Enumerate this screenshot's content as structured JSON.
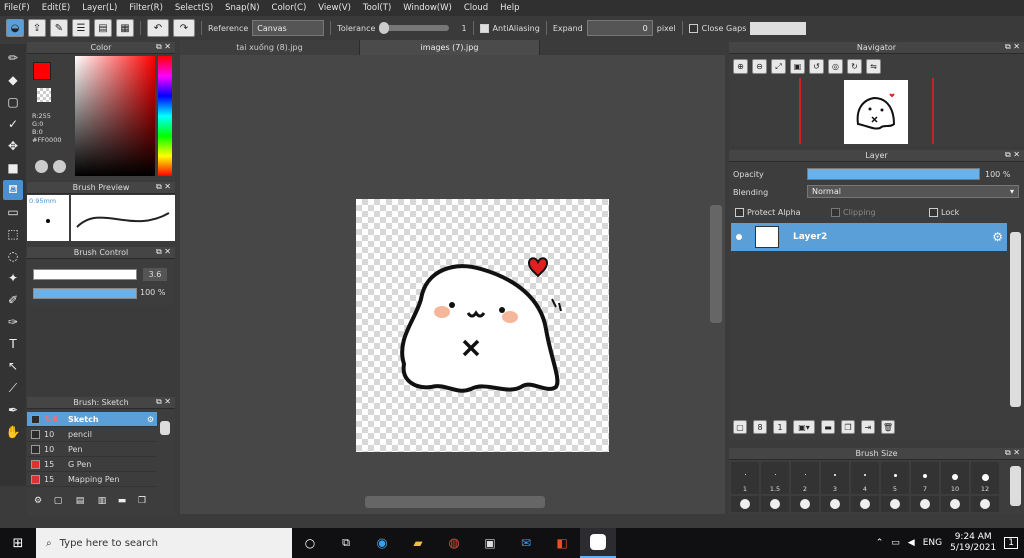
{
  "menu": [
    "File(F)",
    "Edit(E)",
    "Layer(L)",
    "Filter(R)",
    "Select(S)",
    "Snap(N)",
    "Color(C)",
    "View(V)",
    "Tool(T)",
    "Window(W)",
    "Cloud",
    "Help"
  ],
  "toolbar": {
    "reference_label": "Reference",
    "reference_value": "Canvas",
    "tolerance_label": "Tolerance",
    "tolerance_value": "1",
    "antialiasing_label": "AntiAliasing",
    "expand_label": "Expand",
    "expand_value": "0",
    "pixel_label": "pixel",
    "close_gaps_label": "Close Gaps"
  },
  "color_panel": {
    "title": "Color",
    "r": "R:255",
    "g": "G:0",
    "b": "B:0",
    "hex": "#FF0000",
    "primary": "#ff0000"
  },
  "brush_preview": {
    "title": "Brush Preview",
    "size": "0.95mm"
  },
  "brush_control": {
    "title": "Brush Control",
    "size_value": "3.6",
    "size_fraction": 0.98,
    "opacity_value": "100 %",
    "opacity_fraction": 1.0
  },
  "brush_list": {
    "title": "Brush: Sketch",
    "items": [
      {
        "size": "3.6",
        "name": "Sketch",
        "color": "#2b2b2b",
        "selected": true
      },
      {
        "size": "10",
        "name": "pencil",
        "color": "#2b2b2b",
        "selected": false
      },
      {
        "size": "10",
        "name": "Pen",
        "color": "#2b2b2b",
        "selected": false
      },
      {
        "size": "15",
        "name": "G Pen",
        "color": "#e03030",
        "selected": false
      },
      {
        "size": "15",
        "name": "Mapping Pen",
        "color": "#e03030",
        "selected": false
      }
    ]
  },
  "tabs": [
    "tai xuống (8).jpg",
    "images (7).jpg"
  ],
  "navigator": {
    "title": "Navigator"
  },
  "layer_panel": {
    "title": "Layer",
    "opacity_label": "Opacity",
    "opacity_value": "100 %",
    "opacity_fraction": 1.0,
    "blending_label": "Blending",
    "blending_value": "Normal",
    "protect_alpha": "Protect Alpha",
    "clipping": "Clipping",
    "lock": "Lock",
    "layer_name": "Layer2"
  },
  "brush_size": {
    "title": "Brush Size",
    "sizes": [
      "1",
      "1.5",
      "2",
      "3",
      "4",
      "5",
      "7",
      "10",
      "12"
    ]
  },
  "taskbar": {
    "search_placeholder": "Type here to search",
    "lang": "ENG",
    "time": "9:24 AM",
    "date": "5/19/2021",
    "notif": "1"
  }
}
